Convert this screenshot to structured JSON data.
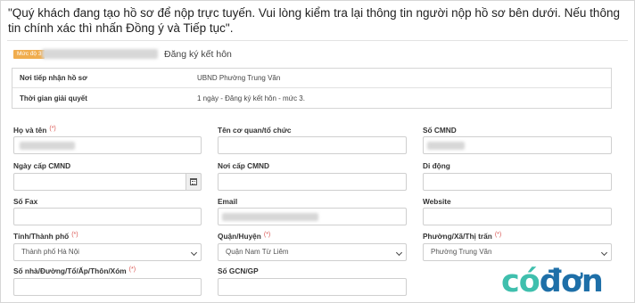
{
  "intro": "\"Quý khách đang tạo hồ sơ để nộp trực tuyến. Vui lòng kiểm tra lại thông tin người nộp hồ sơ bên dưới. Nếu thông tin chính xác thì nhấn Đồng ý và Tiếp tục\".",
  "service": {
    "level_badge": "Mức độ 3",
    "name": "Đăng ký kết hôn"
  },
  "info": [
    {
      "key": "Nơi tiếp nhận hồ sơ",
      "value": "UBND Phường Trung Văn"
    },
    {
      "key": "Thời gian giải quyết",
      "value": "1 ngày - Đăng ký kết hôn - mức 3."
    }
  ],
  "form": {
    "full_name": {
      "label": "Họ và tên",
      "required_mark": "(*)",
      "value": ""
    },
    "organization": {
      "label": "Tên cơ quan/tổ chức",
      "value": ""
    },
    "id_number": {
      "label": "Số CMND",
      "value": ""
    },
    "id_issue_date": {
      "label": "Ngày cấp CMND",
      "value": ""
    },
    "id_issue_place": {
      "label": "Nơi cấp CMND",
      "value": ""
    },
    "mobile": {
      "label": "Di động",
      "value": ""
    },
    "fax": {
      "label": "Số Fax",
      "value": ""
    },
    "email": {
      "label": "Email",
      "value": ""
    },
    "website": {
      "label": "Website",
      "value": ""
    },
    "province": {
      "label": "Tỉnh/Thành phố",
      "required_mark": "(*)",
      "value": "Thành phố Hà Nội"
    },
    "district": {
      "label": "Quận/Huyện",
      "required_mark": "(*)",
      "value": "Quận Nam Từ Liêm"
    },
    "ward": {
      "label": "Phường/Xã/Thị trấn",
      "required_mark": "(*)",
      "value": "Phường Trung Văn"
    },
    "address": {
      "label": "Số nhà/Đường/Tổ/Ấp/Thôn/Xóm",
      "required_mark": "(*)",
      "value": ""
    },
    "gcn_gp": {
      "label": "Số GCN/GP",
      "value": ""
    }
  },
  "icons": {
    "calendar": "calendar-icon",
    "select_arrow": "chevron-down-icon"
  },
  "logo": {
    "part1": "có",
    "part2": "đơn"
  },
  "colors": {
    "badge": "#f0ad4e",
    "required": "#d9534f",
    "logo_teal": "#3fbfad",
    "logo_blue": "#1e6fa8"
  }
}
